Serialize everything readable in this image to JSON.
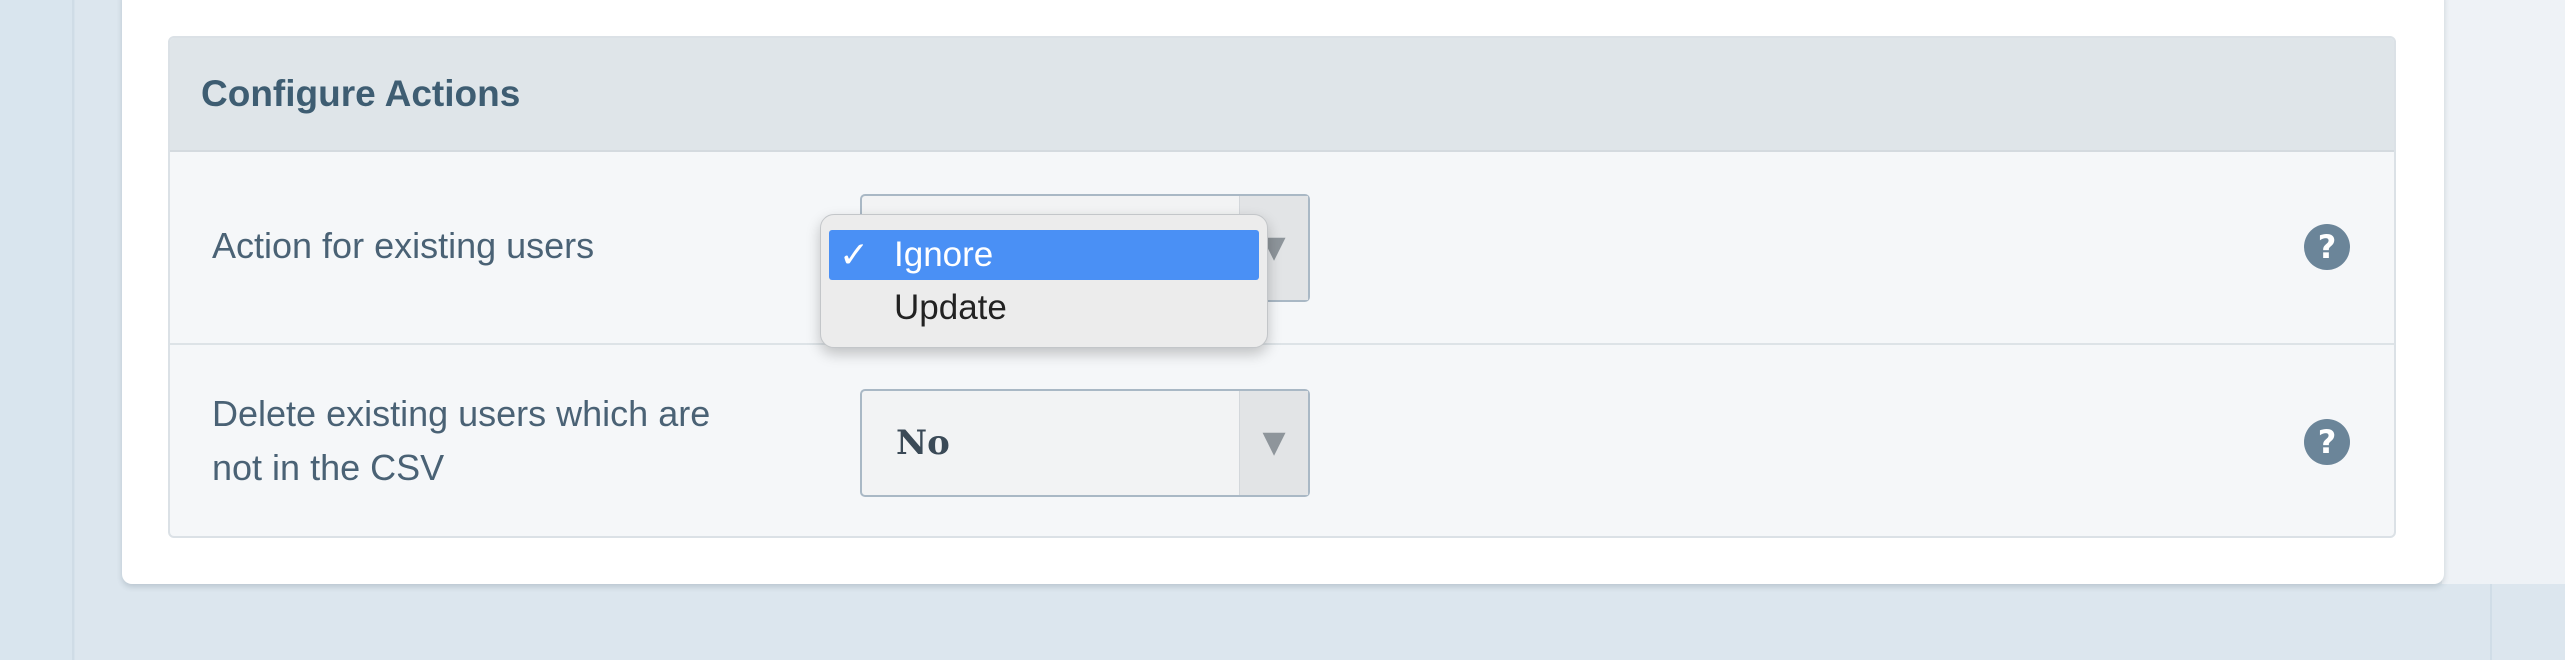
{
  "panel": {
    "title": "Configure Actions"
  },
  "settings": [
    {
      "label": "Action for existing users",
      "selected_value": "Ignore"
    },
    {
      "label": "Delete existing users which are not in the CSV",
      "selected_value": "No"
    }
  ],
  "dropdown": {
    "check_glyph": "✓",
    "options": [
      "Ignore",
      "Update"
    ],
    "selected_index": 0
  },
  "icons": {
    "help": "question-circle-icon",
    "select_arrow": "triangle-down-icon",
    "check": "checkmark-icon"
  },
  "colors": {
    "selected_highlight": "#4a90f5",
    "title_text": "#3e5d72",
    "help_icon": "#6b8599"
  }
}
